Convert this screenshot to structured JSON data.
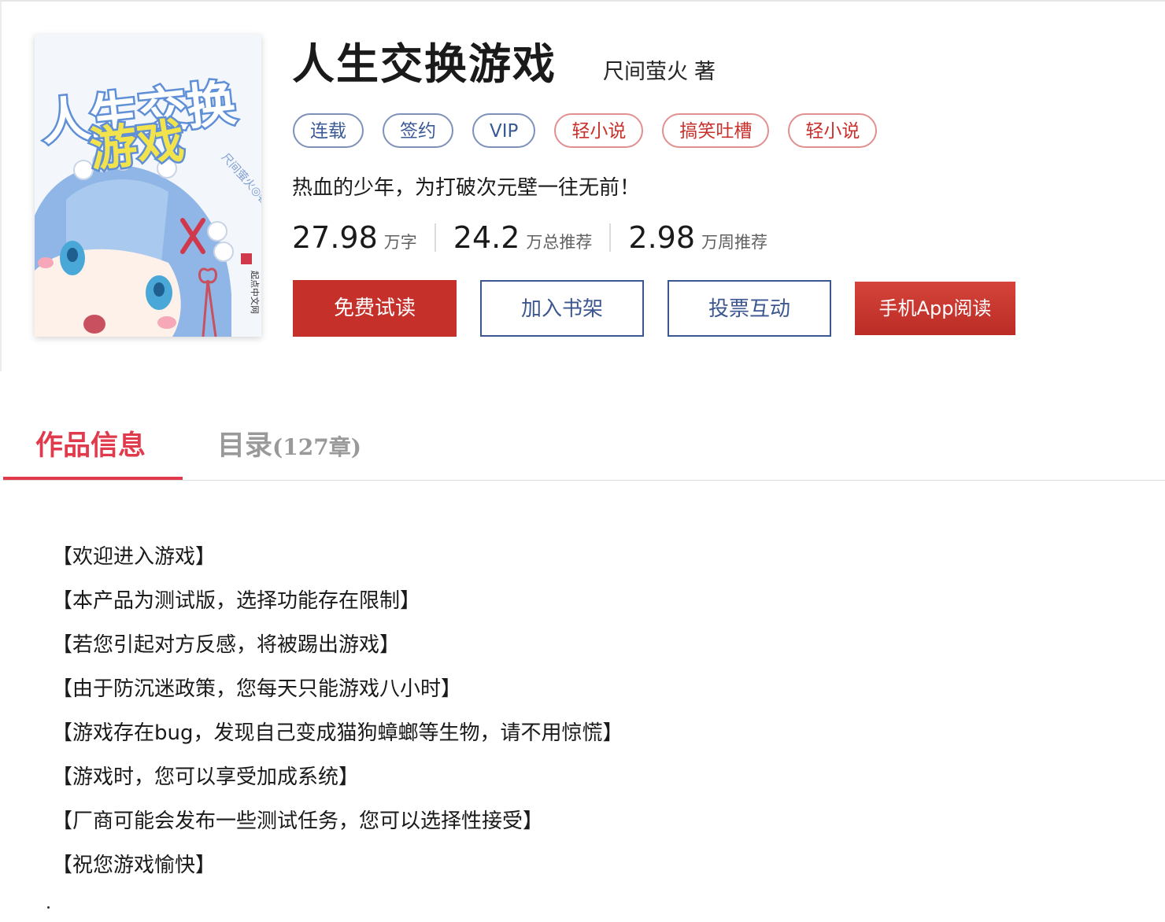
{
  "book": {
    "title": "人生交换游戏",
    "author": "尺间萤火",
    "author_suffix": "著",
    "cover_text": {
      "title_line1": "人生交换",
      "title_line2": "游戏",
      "author_mark": "尺间萤火◎著",
      "publisher_mark": "起点中文网"
    },
    "tags": [
      {
        "label": "连载",
        "style": "blue"
      },
      {
        "label": "签约",
        "style": "blue"
      },
      {
        "label": "VIP",
        "style": "blue"
      },
      {
        "label": "轻小说",
        "style": "red"
      },
      {
        "label": "搞笑吐槽",
        "style": "red"
      },
      {
        "label": "轻小说",
        "style": "red"
      }
    ],
    "intro": "热血的少年，为打破次元壁一往无前！",
    "stats": [
      {
        "value": "27.98",
        "unit": "万字"
      },
      {
        "value": "24.2",
        "unit": "万总推荐"
      },
      {
        "value": "2.98",
        "unit": "万周推荐"
      }
    ]
  },
  "actions": {
    "free_read": "免费试读",
    "add_shelf": "加入书架",
    "vote": "投票互动",
    "app_read": "手机App阅读"
  },
  "tabs": {
    "info": "作品信息",
    "catalog": "目录",
    "catalog_count": "(127章)"
  },
  "description": [
    "【欢迎进入游戏】",
    "【本产品为测试版，选择功能存在限制】",
    "【若您引起对方反感，将被踢出游戏】",
    "【由于防沉迷政策，您每天只能游戏八小时】",
    "【游戏存在bug，发现自己变成猫狗蟑螂等生物，请不用惊慌】",
    "【游戏时，您可以享受加成系统】",
    "【厂商可能会发布一些测试任务，您可以选择性接受】",
    "【祝您游戏愉快】"
  ],
  "colors": {
    "accent_red": "#c6302b",
    "tab_active": "#e03a4c",
    "outline_blue": "#3b5690"
  }
}
